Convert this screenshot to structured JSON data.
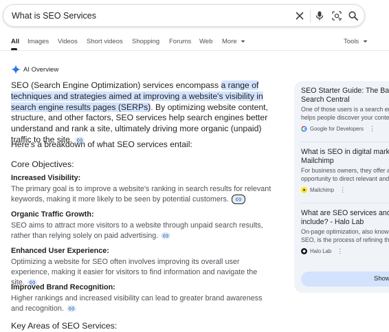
{
  "search": {
    "query": "What is SEO Services"
  },
  "tabs": [
    {
      "label": "All",
      "active": true
    },
    {
      "label": "Images"
    },
    {
      "label": "Videos"
    },
    {
      "label": "Short videos"
    },
    {
      "label": "Shopping"
    },
    {
      "label": "Forums"
    },
    {
      "label": "Web"
    },
    {
      "label": "More"
    },
    {
      "label": "Tools"
    }
  ],
  "ai_overview": {
    "label": "AI Overview",
    "intro_pre": "SEO (Search Engine Optimization) services encompass ",
    "intro_highlight": "a range of techniques and strategies aimed at improving a website's visibility in search engine results pages (SERPs)",
    "intro_post": ". By optimizing website content, structure, and other factors, SEO services help search engines better understand and rank a site, ultimately driving more organic (unpaid) traffic to the site.",
    "breakdown": "Here's a breakdown of what SEO services entail:",
    "core_heading": "Core Objectives:",
    "items": [
      {
        "title": "Increased Visibility:",
        "body": "The primary goal is to improve a website's ranking in search results for relevant keywords, making it more likely to be seen by potential customers."
      },
      {
        "title": "Organic Traffic Growth:",
        "body": "SEO aims to attract more visitors to a website through unpaid search results, rather than relying solely on paid advertising."
      },
      {
        "title": "Enhanced User Experience:",
        "body": "Optimizing a website for SEO often involves improving its overall user experience, making it easier for visitors to find information and navigate the site."
      },
      {
        "title": "Improved Brand Recognition:",
        "body": "Higher rankings and increased visibility can lead to greater brand awareness and recognition."
      }
    ],
    "key_areas_heading": "Key Areas of SEO Services:"
  },
  "sources": [
    {
      "title_lines": [
        "SEO Starter Guide: The Basic",
        "Search Central"
      ],
      "desc_lines": [
        "One of those users is a search en",
        "helps people discover your conter"
      ],
      "source": "Google for Developers",
      "favicon": "google-icon"
    },
    {
      "title_lines": [
        "What is SEO in digital market",
        "Mailchimp"
      ],
      "desc_lines": [
        "For business owners, they offer a",
        "opportunity to direct relevant and"
      ],
      "source": "Mailchimp",
      "favicon": "mailchimp-icon"
    },
    {
      "title_lines": [
        "What are SEO services and w",
        "include? - Halo Lab"
      ],
      "desc_lines": [
        "On-page optimization, also know",
        "SEO, is the process of refining the"
      ],
      "source": "Halo Lab",
      "favicon": "halo-lab-icon"
    }
  ],
  "show_all_label": "Show",
  "colors": {
    "highlight": "#d3e3fd",
    "panel_bg": "#f0f4f9",
    "accent_blue": "#1a73e8"
  }
}
